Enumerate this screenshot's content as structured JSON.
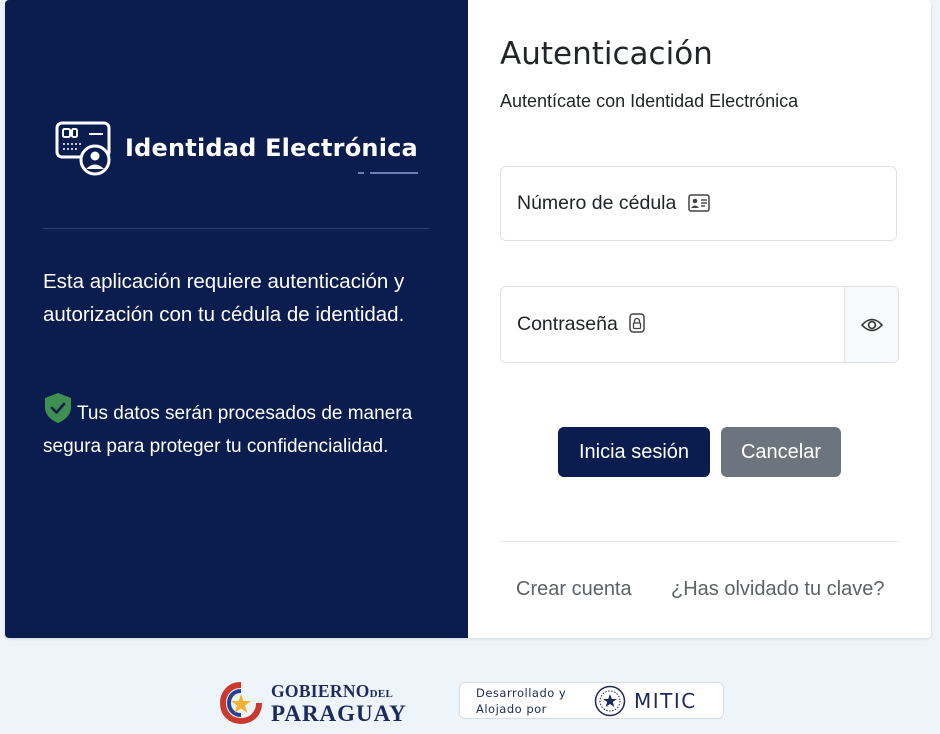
{
  "brand": {
    "name": "Identidad Electrónica"
  },
  "left_panel": {
    "intro": "Esta aplicación requiere autenticación y autorización con tu cédula de identidad.",
    "secure_note": "Tus datos serán procesados de manera segura para proteger tu confidencialidad."
  },
  "auth": {
    "title": "Autenticación",
    "subtitle": "Autentícate con Identidad Electrónica",
    "cedula_label": "Número de cédula",
    "password_label": "Contraseña",
    "login_button": "Inicia sesión",
    "cancel_button": "Cancelar",
    "create_account_link": "Crear cuenta",
    "forgot_link": "¿Has olvidado tu clave?"
  },
  "footer": {
    "gov_line1": "GOBIERNO",
    "gov_line1_small": "DEL",
    "gov_line2": "PARAGUAY",
    "dev_line1": "Desarrollado y",
    "dev_line2": "Alojado por",
    "mitic": "MITIC"
  },
  "colors": {
    "navy": "#0b1c4e",
    "shield_green": "#3f8f52",
    "cancel_gray": "#6c757d"
  },
  "icons": {
    "brand": "id-card-user-icon",
    "secure": "shield-check-icon",
    "cedula": "id-card-icon",
    "password": "lock-icon",
    "toggle": "eye-icon"
  }
}
